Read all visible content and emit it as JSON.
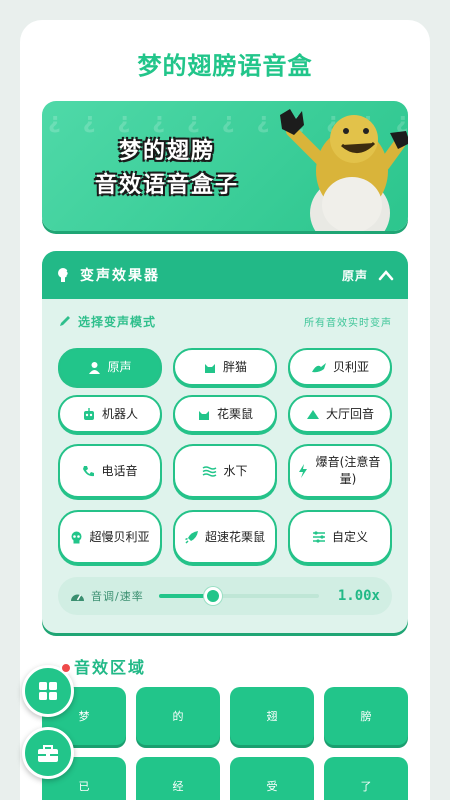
{
  "app": {
    "title": "梦的翅膀语音盒"
  },
  "banner": {
    "line1": "梦的翅膀",
    "line2": "音效语音盒子",
    "bg_pattern": "¿¿¿¿¿¿¿¿¿¿¿¿¿¿¿¿¿¿¿¿¿¿¿¿¿¿¿¿¿¿¿¿"
  },
  "voice_changer": {
    "title": "变声效果器",
    "current_mode": "原声",
    "select_label": "选择变声模式",
    "hint": "所有音效实时变声",
    "modes": [
      {
        "label": "原声",
        "icon": "person-icon",
        "active": true
      },
      {
        "label": "胖猫",
        "icon": "cat-icon"
      },
      {
        "label": "贝利亚",
        "icon": "dragon-icon"
      },
      {
        "label": "机器人",
        "icon": "robot-icon"
      },
      {
        "label": "花栗鼠",
        "icon": "paw-icon"
      },
      {
        "label": "大厅回音",
        "icon": "mountain-icon"
      },
      {
        "label": "电话音",
        "icon": "phone-icon"
      },
      {
        "label": "水下",
        "icon": "water-icon"
      },
      {
        "label": "爆音(注意音量)",
        "icon": "bolt-icon"
      },
      {
        "label": "超慢贝利亚",
        "icon": "skull-icon"
      },
      {
        "label": "超速花栗鼠",
        "icon": "rocket-icon"
      },
      {
        "label": "自定义",
        "icon": "sliders-icon"
      }
    ],
    "pitch": {
      "label": "音调/速率",
      "value_text": "1.00x",
      "level": 0.34
    }
  },
  "sound_area": {
    "title": "音效区域",
    "buttons": [
      "梦",
      "的",
      "翅",
      "膀",
      "已",
      "经",
      "受",
      "了"
    ]
  },
  "colors": {
    "accent": "#22c58a",
    "badge": "#ef4a4a"
  }
}
